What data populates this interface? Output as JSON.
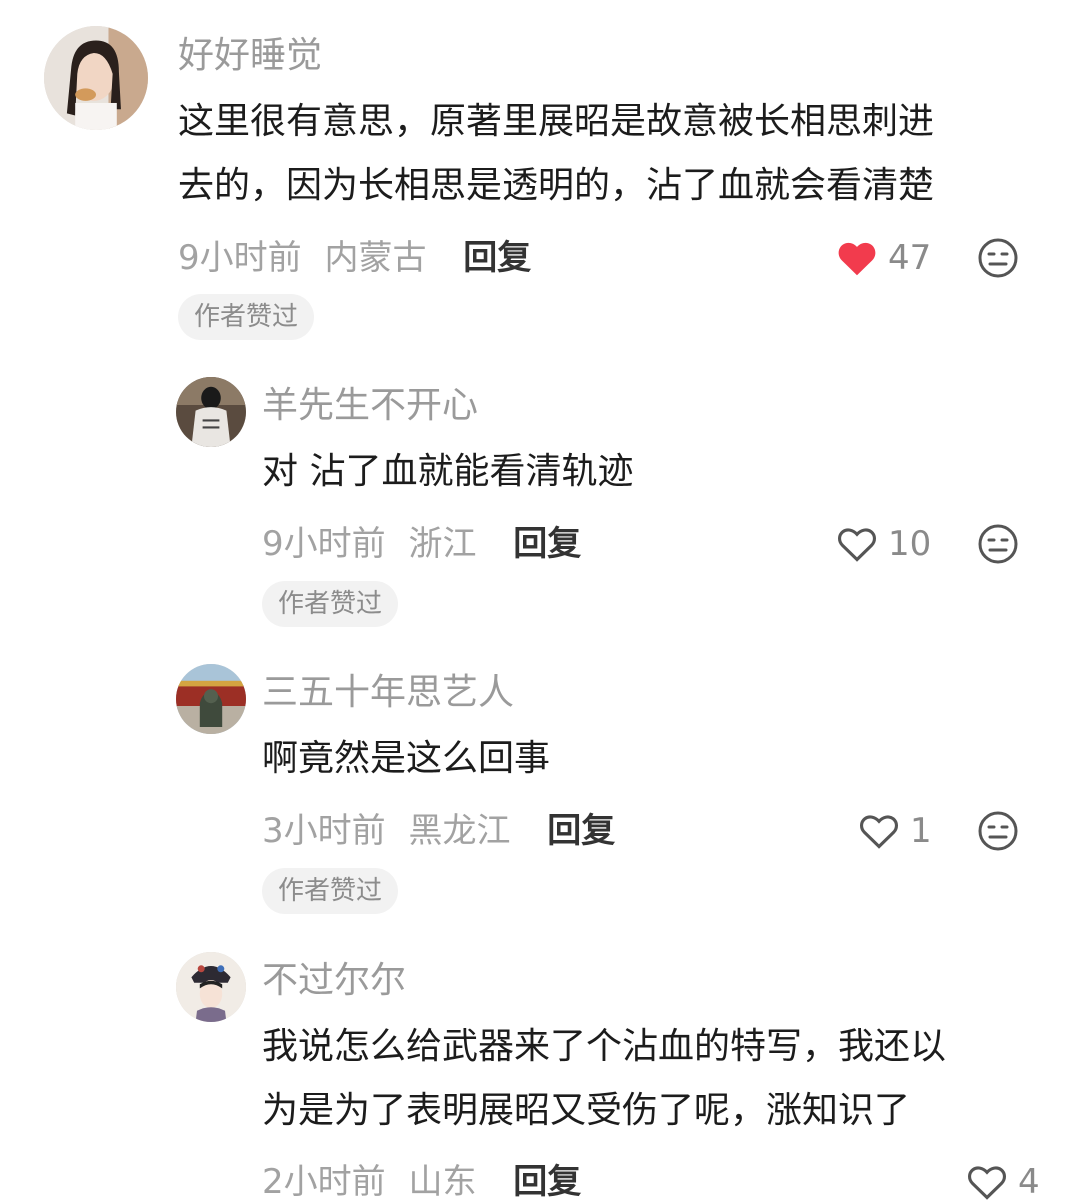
{
  "comments": [
    {
      "username": "好好睡觉",
      "lines": [
        "这里很有意思，原著里展昭是故意被长相思刺进",
        "去的，因为长相思是透明的，沾了血就会看清楚"
      ],
      "time": "9小时前",
      "location": "内蒙古",
      "reply_label": "回复",
      "like_count": "47",
      "liked": true,
      "badge": "作者赞过"
    },
    {
      "username": "羊先生不开心",
      "lines": [
        "对 沾了血就能看清轨迹"
      ],
      "time": "9小时前",
      "location": "浙江",
      "reply_label": "回复",
      "like_count": "10",
      "liked": false,
      "badge": "作者赞过"
    },
    {
      "username": "三五十年思艺人",
      "lines": [
        "啊竟然是这么回事"
      ],
      "time": "3小时前",
      "location": "黑龙江",
      "reply_label": "回复",
      "like_count": "1",
      "liked": false,
      "badge": "作者赞过"
    },
    {
      "username": "不过尔尔",
      "lines": [
        "我说怎么给武器来了个沾血的特写，我还以",
        "为是为了表明展昭又受伤了呢，涨知识了"
      ],
      "time": "2小时前",
      "location": "山东",
      "reply_label": "回复",
      "like_count": "4",
      "liked": false
    }
  ],
  "colors": {
    "like_active": "#f23b4d",
    "icon_gray": "#555555",
    "meta_gray": "#a2a2a2",
    "badge_bg": "#f2f2f2"
  },
  "icons": {
    "like": "heart-icon",
    "dislike": "meh-face-icon"
  }
}
